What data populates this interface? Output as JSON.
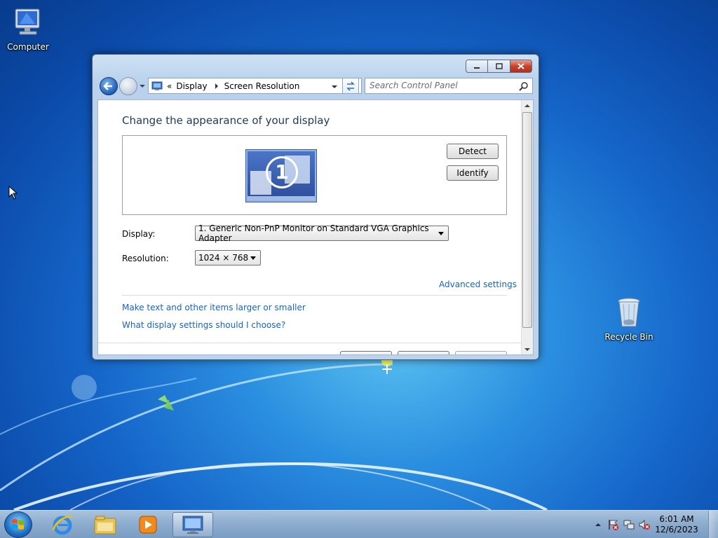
{
  "desktop": {
    "icons": [
      {
        "label": "Computer",
        "icon": "computer-icon"
      },
      {
        "label": "Recycle Bin",
        "icon": "recycle-bin-icon"
      }
    ]
  },
  "window": {
    "address": {
      "prefix": "«",
      "crumbs": [
        "Display",
        "Screen Resolution"
      ]
    },
    "search": {
      "placeholder": "Search Control Panel"
    },
    "heading": "Change the appearance of your display",
    "monitor_number": "1",
    "buttons": {
      "detect": "Detect",
      "identify": "Identify"
    },
    "display": {
      "label": "Display:",
      "value": "1. Generic Non-PnP Monitor on Standard VGA Graphics Adapter"
    },
    "resolution": {
      "label": "Resolution:",
      "value": "1024 × 768"
    },
    "links": {
      "advanced": "Advanced settings",
      "text_size": "Make text and other items larger or smaller",
      "help": "What display settings should I choose?"
    }
  },
  "taskbar": {
    "apps": [
      "internet-explorer-icon",
      "windows-explorer-icon",
      "media-player-icon",
      "display-control-panel-icon"
    ],
    "clock": {
      "time": "6:01 AM",
      "date": "12/6/2023"
    }
  },
  "colors": {
    "accent": "#1e395b",
    "link": "#1565c0"
  }
}
